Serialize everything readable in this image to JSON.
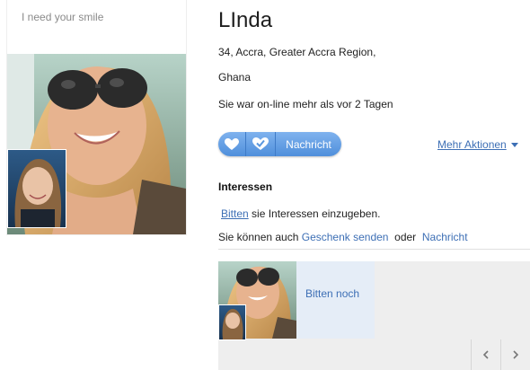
{
  "profile": {
    "status_message": "I need your smile",
    "name": "LInda",
    "age_location": "34,  Accra, Greater Accra Region,",
    "country": "Ghana",
    "last_online": "Sie war on-line mehr als vor 2 Tagen"
  },
  "actions": {
    "like_icon": "heart-icon",
    "favorite_icon": "heart-check-icon",
    "message_label": "Nachricht",
    "more_actions_label": "Mehr Aktionen"
  },
  "interests": {
    "title": "Interessen",
    "ask_link": "Bitten",
    "ask_text": " sie Interessen einzugeben.",
    "alt_prefix": "Sie können auch ",
    "gift_link": "Geschenk senden",
    "or_text": "oder",
    "message_link": "Nachricht"
  },
  "gallery": {
    "request_label": "Bitten noch",
    "prev_icon": "chevron-left-icon",
    "next_icon": "chevron-right-icon"
  },
  "colors": {
    "accent": "#4f8fdb",
    "link": "#3d6fb5"
  }
}
